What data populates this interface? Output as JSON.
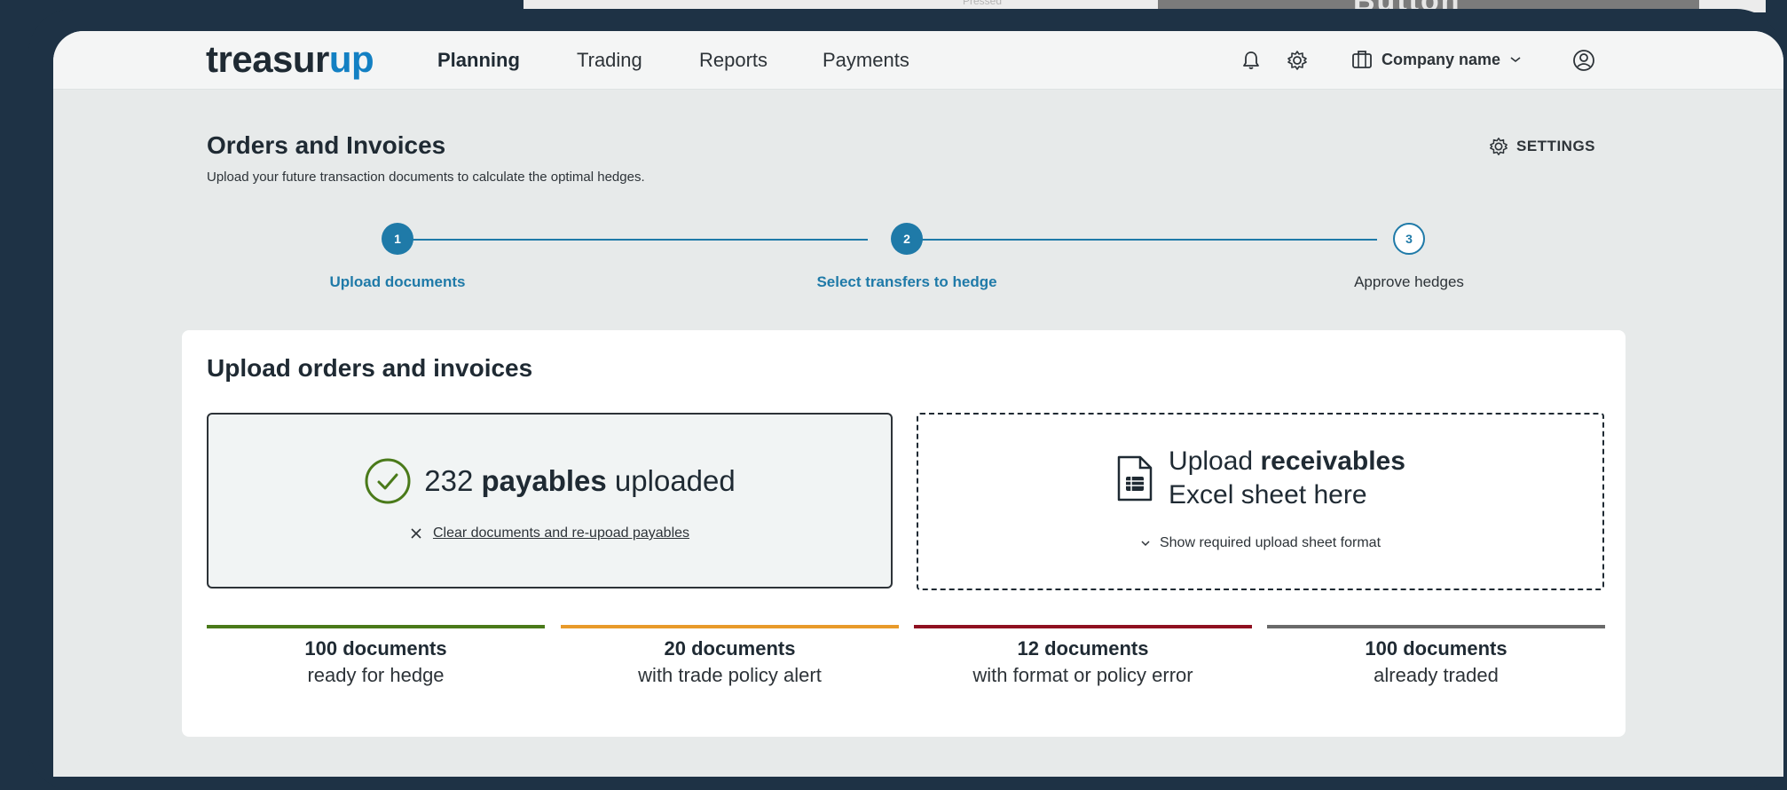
{
  "background": {
    "fragment_text": "Pressed",
    "fragment_button": "Button"
  },
  "nav": {
    "logo_main": "treasur",
    "logo_accent": "up",
    "items": [
      {
        "label": "Planning",
        "active": true
      },
      {
        "label": "Trading",
        "active": false
      },
      {
        "label": "Reports",
        "active": false
      },
      {
        "label": "Payments",
        "active": false
      }
    ],
    "icons": [
      "bell-icon",
      "gear-icon",
      "briefcase-icon",
      "chevron-down-icon",
      "user-icon"
    ],
    "company": "Company name"
  },
  "page": {
    "title": "Orders and Invoices",
    "subtitle": "Upload your future transaction documents to calculate the optimal hedges.",
    "settings_label": "SETTINGS"
  },
  "stepper": {
    "steps": [
      {
        "number": "1",
        "label": "Upload documents",
        "state": "done"
      },
      {
        "number": "2",
        "label": "Select transfers to hedge",
        "state": "done"
      },
      {
        "number": "3",
        "label": "Approve hedges",
        "state": "todo"
      }
    ]
  },
  "upload": {
    "title": "Upload orders and invoices",
    "payables": {
      "count": "232",
      "type": "payables",
      "suffix": "uploaded",
      "clear_link": "Clear documents and re-upoad payables"
    },
    "receivables": {
      "prefix": "Upload",
      "type": "receivables",
      "line2": "Excel sheet here",
      "format_toggle": "Show required upload sheet format"
    }
  },
  "stats": [
    {
      "count": "100 documents",
      "desc": "ready for hedge",
      "color": "#4a7a1a"
    },
    {
      "count": "20 documents",
      "desc": "with trade policy alert",
      "color": "#e89a2a"
    },
    {
      "count": "12 documents",
      "desc": "with format or policy error",
      "color": "#8f1020"
    },
    {
      "count": "100 documents",
      "desc": "already traded",
      "color": "#6a6a6a"
    }
  ],
  "colors": {
    "accent": "#1f7aa8",
    "logo_accent": "#1380c3",
    "success": "#4a7a1a",
    "frame": "#1e3245"
  }
}
